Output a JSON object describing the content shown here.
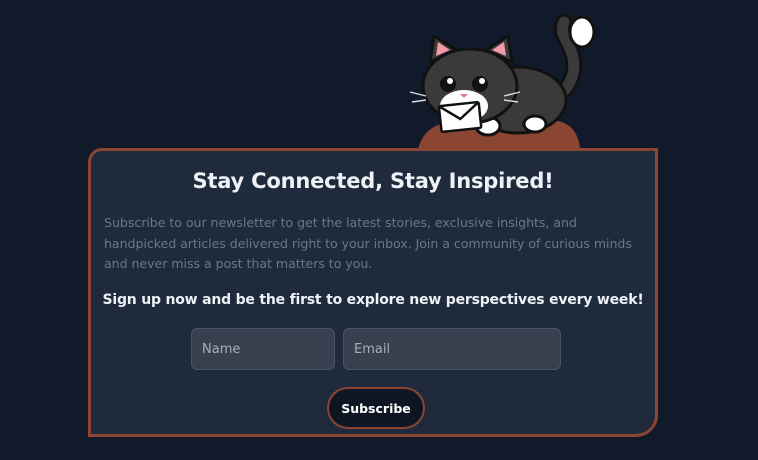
{
  "newsletter": {
    "title": "Stay Connected, Stay Inspired!",
    "description": "Subscribe to our newsletter to get the latest stories, exclusive insights, and handpicked articles delivered right to your inbox. Join a community of curious minds and never miss a post that matters to you.",
    "cta": "Sign up now and be the first to explore new perspectives every week!",
    "name_placeholder": "Name",
    "email_placeholder": "Email",
    "subscribe_label": "Subscribe"
  },
  "mascot": {
    "icon": "cat-holding-envelope-icon"
  },
  "colors": {
    "background": "#111a2b",
    "card": "#1f2a3d",
    "accent": "#8a4631",
    "input": "#37404f"
  }
}
